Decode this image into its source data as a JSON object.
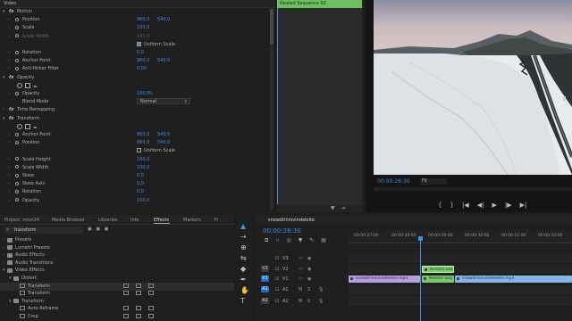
{
  "effect_controls": {
    "header": "Video",
    "rows": [
      {
        "type": "fx",
        "label": "Motion",
        "open": true
      },
      {
        "type": "prop",
        "label": "Position",
        "v1": "960,0",
        "v2": "540,0",
        "stop": true
      },
      {
        "type": "prop",
        "label": "Scale",
        "v1": "100,0",
        "stop": true
      },
      {
        "type": "prop",
        "label": "Scale Width",
        "v1": "100,0",
        "dis": true,
        "stop": true
      },
      {
        "type": "check",
        "checked": true,
        "label": "Uniform Scale"
      },
      {
        "type": "prop",
        "label": "Rotation",
        "v1": "0,0",
        "stop": true
      },
      {
        "type": "prop",
        "label": "Anchor Point",
        "v1": "960,0",
        "v2": "540,0",
        "stop": true
      },
      {
        "type": "prop",
        "label": "Anti-flicker Filter",
        "v1": "0,00",
        "stop": true
      },
      {
        "type": "fx",
        "label": "Opacity",
        "open": true
      },
      {
        "type": "masks"
      },
      {
        "type": "prop",
        "label": "Opacity",
        "v1": "100,0",
        "unit": "%",
        "stop": true
      },
      {
        "type": "select",
        "label": "Blend Mode",
        "value": "Normal"
      },
      {
        "type": "fx",
        "label": "Time Remapping",
        "open": false
      },
      {
        "type": "fx",
        "label": "Transform",
        "open": true
      },
      {
        "type": "masks"
      },
      {
        "type": "prop",
        "label": "Anchor Point",
        "v1": "960,0",
        "v2": "540,0",
        "stop": true
      },
      {
        "type": "prop",
        "label": "Position",
        "v1": "960,0",
        "v2": "540,0",
        "stop": true
      },
      {
        "type": "check",
        "checked": false,
        "label": "Uniform Scale"
      },
      {
        "type": "prop",
        "label": "Scale Height",
        "v1": "100,0",
        "stop": true
      },
      {
        "type": "prop",
        "label": "Scale Width",
        "v1": "100,0",
        "stop": true
      },
      {
        "type": "prop",
        "label": "Skew",
        "v1": "0,0",
        "stop": true
      },
      {
        "type": "prop",
        "label": "Skew Axis",
        "v1": "0,0",
        "stop": true
      },
      {
        "type": "prop",
        "label": "Rotation",
        "v1": "0,0",
        "stop": true
      },
      {
        "type": "prop",
        "label": "Opacity",
        "v1": "100,0",
        "stop": true
      }
    ],
    "mini_timeline_clip": "Nested Sequence 02"
  },
  "program_monitor": {
    "timecode": "00:00:28:30",
    "fit_label": "Fit",
    "controls": [
      "{",
      "}",
      "|◀",
      "◀|",
      "▶",
      "|▶",
      "▶|"
    ]
  },
  "left_panel": {
    "tabs": [
      {
        "label": "Project: movi24",
        "active": false
      },
      {
        "label": "Media Browser",
        "active": false
      },
      {
        "label": "Libraries",
        "active": false
      },
      {
        "label": "Info",
        "active": false
      },
      {
        "label": "Effects",
        "active": true
      },
      {
        "label": "Markers",
        "active": false
      },
      {
        "label": "H",
        "active": false
      }
    ],
    "search_value": "transform",
    "tree": [
      {
        "label": "Presets",
        "level": 0,
        "kind": "folder"
      },
      {
        "label": "Lumetri Presets",
        "level": 0,
        "kind": "folder"
      },
      {
        "label": "Audio Effects",
        "level": 0,
        "kind": "folder"
      },
      {
        "label": "Audio Transitions",
        "level": 0,
        "kind": "folder"
      },
      {
        "label": "Video Effects",
        "level": 0,
        "kind": "folder",
        "open": true
      },
      {
        "label": "Distort",
        "level": 1,
        "kind": "folder",
        "open": true
      },
      {
        "label": "Transform",
        "level": 2,
        "kind": "effect",
        "hl": true
      },
      {
        "label": "Transform",
        "level": 2,
        "kind": "effect"
      },
      {
        "label": "Transform",
        "level": 1,
        "kind": "folder",
        "open": true
      },
      {
        "label": "Auto Reframe",
        "level": 2,
        "kind": "effect"
      },
      {
        "label": "Crop",
        "level": 2,
        "kind": "effect"
      }
    ]
  },
  "timeline": {
    "sequence_name": "snowdrinnivindelelte",
    "timecode": "00:00:28:30",
    "ruler_ticks": [
      "00:00:27:00",
      "00:00:28:00",
      "00:00:29:00",
      "00:00:30:00",
      "00:00:31:00",
      "00:00:32:00"
    ],
    "tracks": [
      {
        "name": "V3",
        "target": "",
        "on": false
      },
      {
        "name": "V2",
        "target": "V2",
        "on": false
      },
      {
        "name": "V1",
        "target": "V1",
        "on": true
      },
      {
        "name": "A1",
        "target": "A1",
        "on": true
      },
      {
        "name": "A2",
        "target": "A2",
        "on": false
      }
    ],
    "clips": [
      {
        "label": "Nested Seq",
        "track": 1,
        "color": "#7ccf6f",
        "text": "#173f12"
      },
      {
        "label": "snowdrinnivindelelte.mp4",
        "track": 2,
        "color": "#b59fe0",
        "text": "#2d1f52"
      },
      {
        "label": "Nested Seq",
        "track": 2,
        "color": "#78c96b",
        "text": "#173f12"
      },
      {
        "label": "snowdrinnivindelelte.mp4",
        "track": 2,
        "color": "#89b4e8",
        "text": "#15304d"
      }
    ],
    "tool_icons": [
      "selection-tool",
      "track-select-tool",
      "ripple-edit-tool",
      "razor-tool",
      "slip-tool",
      "pen-tool",
      "hand-tool",
      "type-tool"
    ]
  },
  "colors": {
    "accent": "#3d8fe0",
    "nested_clip": "#7ccf6f"
  }
}
